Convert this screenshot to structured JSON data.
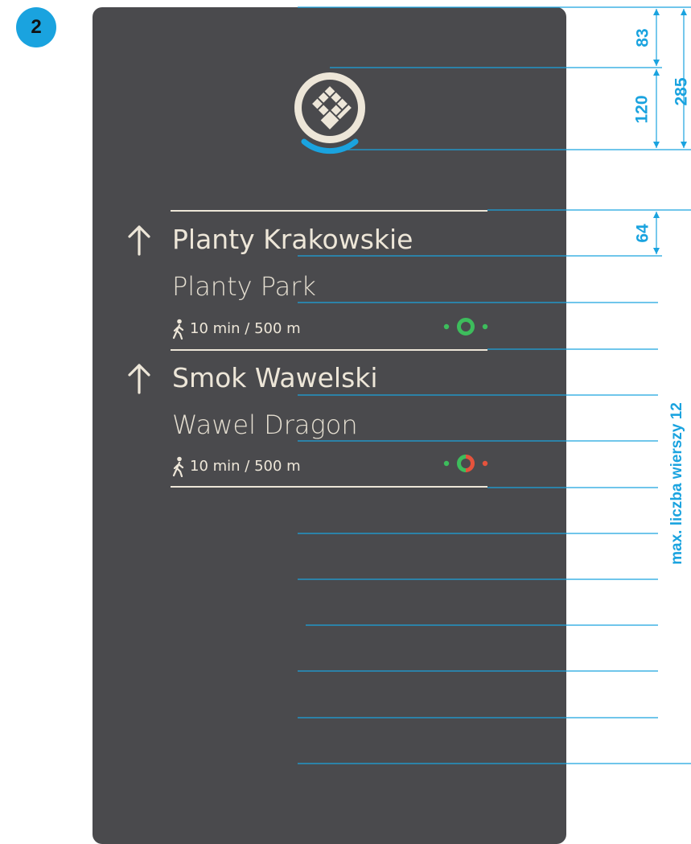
{
  "step_badge": "2",
  "destinations": [
    {
      "direction": "up",
      "name_primary": "Planty Krakowskie",
      "name_secondary": "Planty Park",
      "walk_info": "10 min / 500 m",
      "route_icon": "green-circle-route-icon"
    },
    {
      "direction": "up",
      "name_primary": "Smok Wawelski",
      "name_secondary": "Wawel Dragon",
      "walk_info": "10 min / 500 m",
      "route_icon": "green-red-circle-route-icon"
    }
  ],
  "dimensions": {
    "top_margin": "83",
    "logo_height": "120",
    "logo_total": "285",
    "line_spacing": "64",
    "max_rows_label": "max. liczba wierszy 12"
  },
  "colors": {
    "panel": "#4a4a4d",
    "text": "#ede6d8",
    "guide": "#1aa3df",
    "route_green": "#3dbd5c",
    "route_red": "#e5533c"
  },
  "icons": {
    "logo": "krakow-diamond-logo-icon",
    "arrow": "arrow-up-icon",
    "walk": "walking-person-icon"
  }
}
